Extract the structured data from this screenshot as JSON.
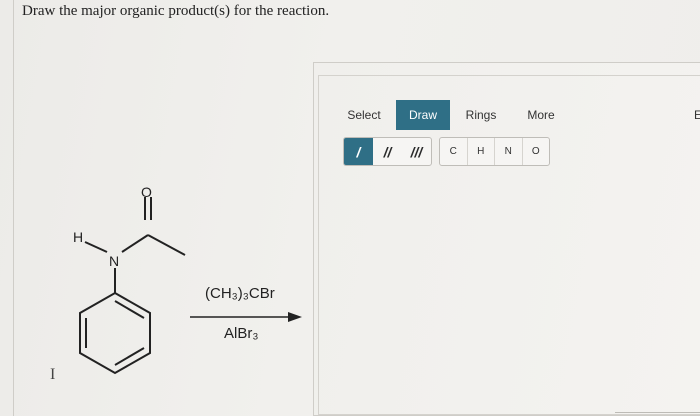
{
  "question": {
    "text": "Draw the major organic product(s) for the reaction."
  },
  "molecule": {
    "atoms": {
      "oxygen": "O",
      "nitrogen": "N",
      "hydrogen": "H"
    }
  },
  "reaction": {
    "reagent_top": "(CH₃)₃CBr",
    "reagent_bottom": "AlBr₃"
  },
  "editor": {
    "tabs": [
      {
        "label": "Select",
        "active": false
      },
      {
        "label": "Draw",
        "active": true
      },
      {
        "label": "Rings",
        "active": false
      },
      {
        "label": "More",
        "active": false
      },
      {
        "label": "E",
        "active": false
      }
    ],
    "bond_tools": [
      {
        "label": "/",
        "icon": "single-bond-icon",
        "active": true
      },
      {
        "label": "//",
        "icon": "double-bond-icon",
        "active": false
      },
      {
        "label": "///",
        "icon": "triple-bond-icon",
        "active": false
      }
    ],
    "atom_tools": [
      "C",
      "H",
      "N",
      "O"
    ]
  },
  "colors": {
    "accent": "#2f6f86",
    "background": "#efeeeb"
  },
  "cursor": {
    "glyph": "I"
  }
}
